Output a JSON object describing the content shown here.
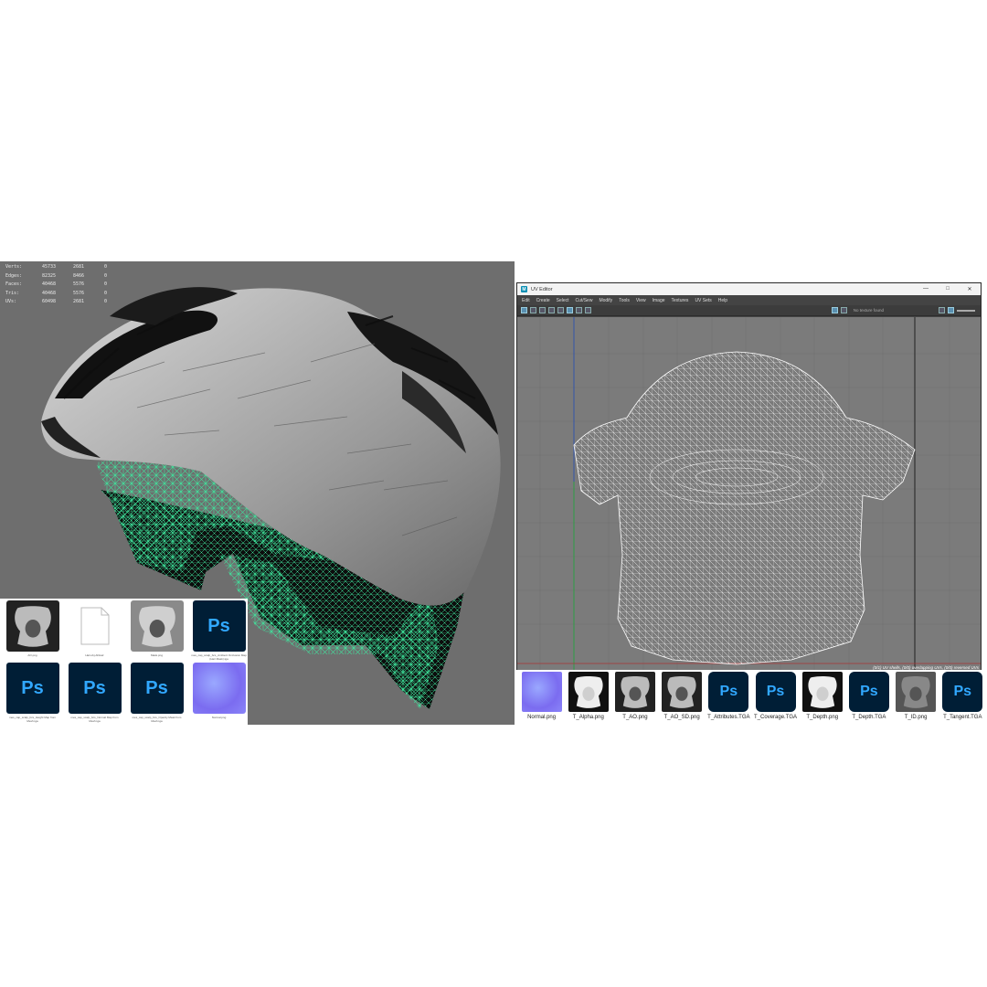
{
  "viewport": {
    "stats": [
      {
        "label": "Verts:",
        "a": "45733",
        "b": "2681",
        "c": "0"
      },
      {
        "label": "Edges:",
        "a": "82325",
        "b": "8466",
        "c": "0"
      },
      {
        "label": "Faces:",
        "a": "40468",
        "b": "5576",
        "c": "0"
      },
      {
        "label": "Tris:",
        "a": "40468",
        "b": "5576",
        "c": "0"
      },
      {
        "label": "UVs:",
        "a": "60498",
        "b": "2681",
        "c": "0"
      }
    ],
    "wire_color": "#3ee89e"
  },
  "thumbs_left": [
    {
      "icon": "ao-map",
      "caption": "AO.png"
    },
    {
      "icon": "blank-file",
      "caption": "Hair.obj.AFHair"
    },
    {
      "icon": "depth-map",
      "caption": "Mask.png"
    },
    {
      "icon": "photoshop",
      "caption": "mes_cap_scalp_bcs_Ambient Occlusion Map (Hair Mask).tga"
    },
    {
      "icon": "photoshop",
      "caption": "mes_cap_scalp_bcs_Height Map from Mesh.tga"
    },
    {
      "icon": "photoshop",
      "caption": "mes_cap_scalp_bcs_Normal Map from Mesh.tga"
    },
    {
      "icon": "photoshop",
      "caption": "mes_cap_scalp_bcs_Opacity Mask from Mesh.tga"
    },
    {
      "icon": "normal-map",
      "caption": "Normal.png"
    }
  ],
  "uv_editor": {
    "title": "UV Editor",
    "menu": [
      "Edit",
      "Create",
      "Select",
      "Cut/Sew",
      "Modify",
      "Tools",
      "View",
      "Image",
      "Textures",
      "UV Sets",
      "Help"
    ],
    "no_texture": "No texture found",
    "status": "(0/1) UV shells, (0/0) overlapping UVs, (0/0) reversed UVs",
    "window_buttons": [
      "—",
      "□",
      "✕"
    ]
  },
  "thumbs_right": [
    {
      "icon": "normal-map",
      "caption": "Normal.png"
    },
    {
      "icon": "alpha-map",
      "caption": "T_Alpha.png"
    },
    {
      "icon": "ao-map",
      "caption": "T_AO.png"
    },
    {
      "icon": "ao-map",
      "caption": "T_AO_SD.png"
    },
    {
      "icon": "photoshop",
      "caption": "T_Attributes.TGA"
    },
    {
      "icon": "photoshop",
      "caption": "T_Coverage.TGA"
    },
    {
      "icon": "alpha-map",
      "caption": "T_Depth.png"
    },
    {
      "icon": "photoshop",
      "caption": "T_Depth.TGA"
    },
    {
      "icon": "noise-map",
      "caption": "T_ID.png"
    },
    {
      "icon": "photoshop",
      "caption": "T_Tangent.TGA"
    }
  ],
  "ps_label": "Ps"
}
